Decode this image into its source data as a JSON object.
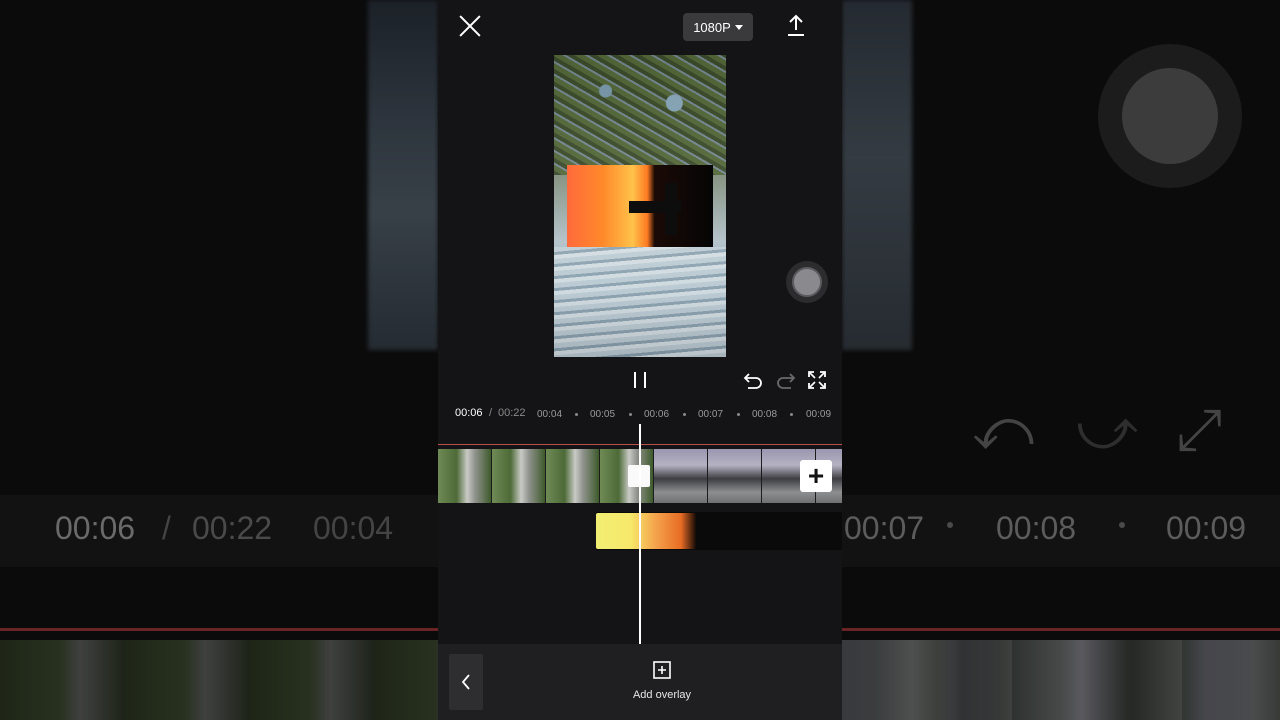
{
  "header": {
    "resolution_label": "1080P"
  },
  "timeline": {
    "current_time": "00:06",
    "separator": "/",
    "total_time": "00:22",
    "ticks": [
      "00:04",
      "00:05",
      "00:06",
      "00:07",
      "00:08",
      "00:09"
    ]
  },
  "bottom_bar": {
    "add_overlay_label": "Add overlay"
  },
  "background_mirror": {
    "current_time": "00:06",
    "separator": "/",
    "total_time": "00:22",
    "ticks": [
      "00:04",
      "00:07",
      "00:08",
      "00:09"
    ]
  },
  "icons": {
    "close": "close-icon",
    "export": "export-icon",
    "pause": "pause-icon",
    "undo": "undo-icon",
    "redo": "redo-icon",
    "fullscreen": "fullscreen-icon",
    "add_clip": "plus-icon",
    "back": "chevron-left-icon",
    "add_overlay": "add-overlay-icon"
  },
  "colors": {
    "accent_line": "#b8504a",
    "panel_bg": "#141416",
    "button_bg": "#3a3a3c"
  }
}
